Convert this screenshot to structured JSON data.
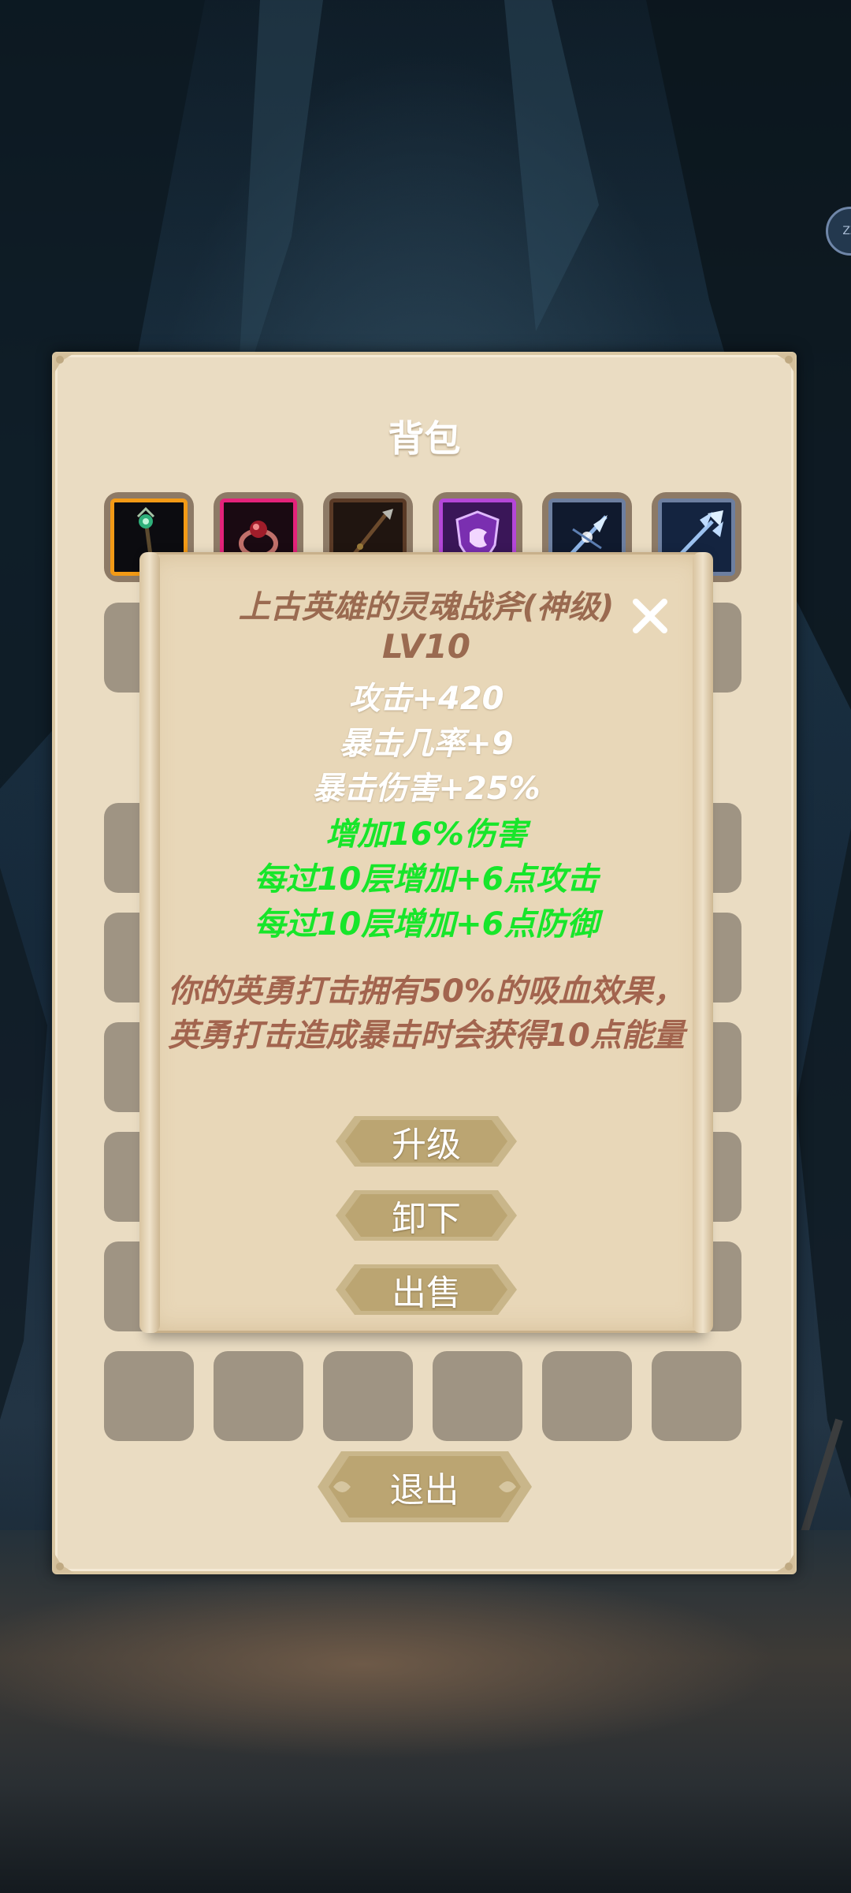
{
  "background": {
    "side_badge": "ZZ"
  },
  "inventory": {
    "title": "背包",
    "equipped_items": [
      {
        "icon": "staff-icon",
        "rarity_color": "#f29a16"
      },
      {
        "icon": "ring-icon",
        "rarity_color": "#e3237a"
      },
      {
        "icon": "spear-icon",
        "rarity_color": "#5a3a26"
      },
      {
        "icon": "shield-emblem-icon",
        "rarity_color": "#b447d8"
      },
      {
        "icon": "ice-weapon-icon",
        "rarity_color": "#6d7fa0"
      },
      {
        "icon": "ice-trident-icon",
        "rarity_color": "#6d7fa0"
      }
    ],
    "exit_label": "退出"
  },
  "item_popup": {
    "name": "上古英雄的灵魂战斧(神级)",
    "level": "LV10",
    "stats": [
      "攻击+420",
      "暴击几率+9",
      "暴击伤害+25%"
    ],
    "bonuses": [
      "增加16%伤害",
      "每过10层增加+6点攻击",
      "每过10层增加+6点防御"
    ],
    "description": "你的英勇打击拥有50%的吸血效果，英勇打击造成暴击时会获得10点能量",
    "buttons": {
      "upgrade": "升级",
      "unequip": "卸下",
      "sell": "出售"
    }
  }
}
